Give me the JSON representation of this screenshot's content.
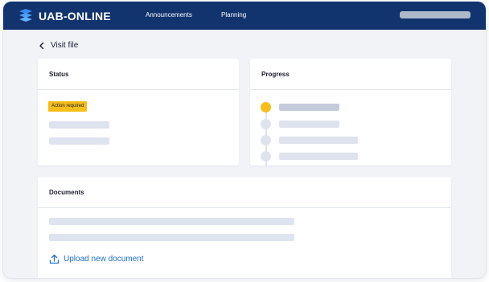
{
  "header": {
    "brand": "UAB-ONLINE",
    "logo_icon": "layers-logo-icon",
    "nav": [
      {
        "label": "Announcements"
      },
      {
        "label": "Planning"
      }
    ],
    "user_menu_icon": "user-placeholder"
  },
  "back_link": {
    "label": "Visit file",
    "icon": "chevron-left-icon"
  },
  "status": {
    "title": "Status",
    "badge": "Action required",
    "badge_color": "#f7bd19"
  },
  "progress": {
    "title": "Progress",
    "steps": [
      {
        "state": "active"
      },
      {
        "state": "pending"
      },
      {
        "state": "pending"
      },
      {
        "state": "pending"
      }
    ]
  },
  "documents": {
    "title": "Documents",
    "upload_label": "Upload new document",
    "upload_icon": "upload-icon",
    "link_color": "#1f6fd6"
  },
  "colors": {
    "header_bg": "#11346f",
    "page_bg": "#f1f3f7",
    "accent": "#f7bd19"
  }
}
